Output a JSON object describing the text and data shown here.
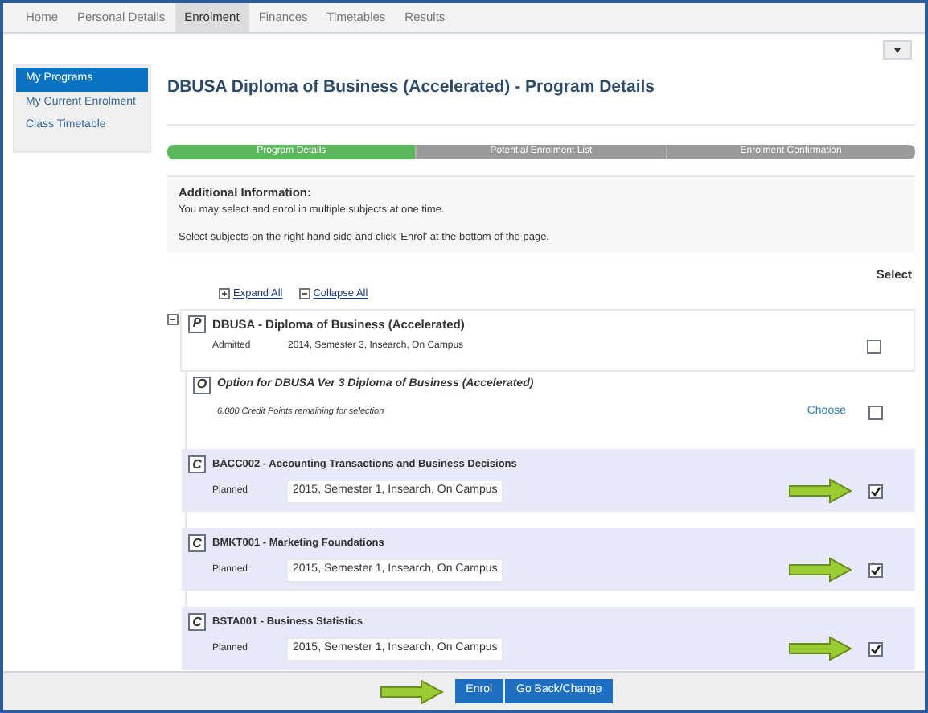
{
  "nav_tabs": [
    {
      "label": "Home",
      "selected": false
    },
    {
      "label": "Personal Details",
      "selected": false
    },
    {
      "label": "Enrolment",
      "selected": true
    },
    {
      "label": "Finances",
      "selected": false
    },
    {
      "label": "Timetables",
      "selected": false
    },
    {
      "label": "Results",
      "selected": false
    }
  ],
  "sidebar": {
    "items": [
      {
        "label": "My Programs",
        "selected": true
      },
      {
        "label": "My Current Enrolment",
        "selected": false
      },
      {
        "label": "Class Timetable",
        "selected": false
      }
    ]
  },
  "page_title": "DBUSA Diploma of Business (Accelerated) - Program Details",
  "steps": [
    {
      "label": "Program Details",
      "selected": true
    },
    {
      "label": "Potential Enrolment List",
      "selected": false
    },
    {
      "label": "Enrolment Confirmation",
      "selected": false
    }
  ],
  "info": {
    "heading": "Additional Information:",
    "lines": [
      "You may select and enrol in multiple subjects at one time.",
      "Select subjects on the right hand side and click 'Enrol' at the bottom of the page."
    ]
  },
  "select_label": "Select",
  "expand_all": "Expand All",
  "collapse_all": "Collapse All",
  "program": {
    "badge": "P",
    "title": "DBUSA - Diploma of Business (Accelerated)",
    "status": "Admitted",
    "detail": "2014, Semester 3, Insearch, On Campus",
    "checked": false,
    "expanded": true
  },
  "option": {
    "badge": "O",
    "title": "Option for DBUSA Ver 3 Diploma of Business (Accelerated)",
    "credits": "6.000 Credit Points remaining for selection",
    "choose": "Choose",
    "checked": false
  },
  "courses": [
    {
      "badge": "C",
      "title": "BACC002 - Accounting Transactions and Business Decisions",
      "status": "Planned",
      "session": "2015, Semester 1, Insearch, On Campus",
      "checked": true
    },
    {
      "badge": "C",
      "title": "BMKT001 - Marketing Foundations",
      "status": "Planned",
      "session": "2015, Semester 1, Insearch, On Campus",
      "checked": true
    },
    {
      "badge": "C",
      "title": "BSTA001 - Business Statistics",
      "status": "Planned",
      "session": "2015, Semester 1, Insearch, On Campus",
      "checked": true
    }
  ],
  "buttons": [
    {
      "label": "Enrol"
    },
    {
      "label": "Go Back/Change"
    }
  ]
}
